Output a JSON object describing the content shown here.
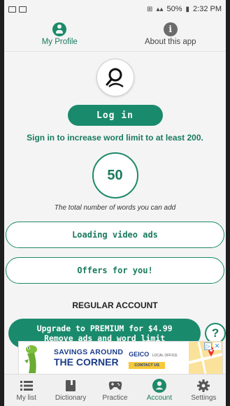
{
  "status_bar": {
    "battery": "50%",
    "time": "2:32 PM"
  },
  "top_tabs": [
    {
      "label": "My Profile",
      "icon": "person-icon",
      "active": true
    },
    {
      "label": "About this app",
      "icon": "info-icon",
      "active": false
    }
  ],
  "profile": {
    "avatar_icon": "user-search-icon",
    "login_label": "Log in",
    "signin_text": "Sign in to increase word limit to at least 200.",
    "word_count": "50",
    "word_count_caption": "The total number of words you can add",
    "video_ads_label": "Loading video ads",
    "offers_label": "Offers for you!",
    "account_type": "REGULAR ACCOUNT",
    "upgrade_line1": "Upgrade to PREMIUM for $4.99",
    "upgrade_line2": "Remove ads and word limit",
    "help_label": "?"
  },
  "ad": {
    "line1": "SAVINGS AROUND",
    "line2": "THE CORNER",
    "brand": "GEICO",
    "brand_tag": "LOCAL OFFICE",
    "cta": "CONTACT US"
  },
  "bottom_nav": [
    {
      "label": "My list",
      "icon": "list-icon",
      "active": false
    },
    {
      "label": "Dictionary",
      "icon": "book-icon",
      "active": false
    },
    {
      "label": "Practice",
      "icon": "gamepad-icon",
      "active": false
    },
    {
      "label": "Account",
      "icon": "account-icon",
      "active": true
    },
    {
      "label": "Settings",
      "icon": "gear-icon",
      "active": false
    }
  ],
  "colors": {
    "accent": "#1a8a6c",
    "accent_text": "#1a7a5e",
    "background": "#f4f4f4"
  }
}
